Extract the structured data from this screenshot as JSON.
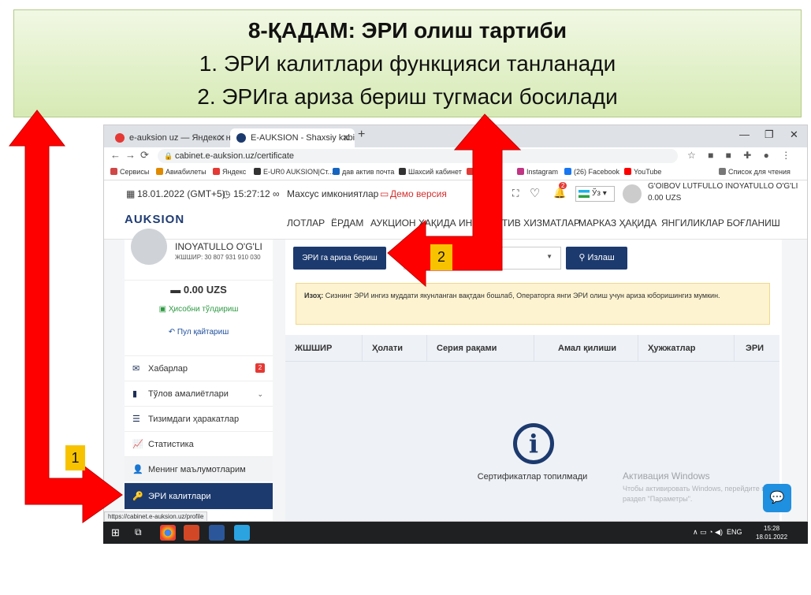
{
  "banner": {
    "title": "8-ҚАДАМ: ЭРИ олиш тартиби",
    "line1": "1.   ЭРИ калитлари функцияси танланади",
    "line2": "2.   ЭРИга ариза бериш тугмаси босилади"
  },
  "browser": {
    "tabs": [
      {
        "label": "e-auksion uz — Яндекс: нашлось"
      },
      {
        "label": "E-AUKSION - Shaxsiy kabinet"
      }
    ],
    "url": "cabinet.e-auksion.uz/certificate",
    "bookmarks": [
      "Сервисы",
      "Авиабилеты",
      "Яндекс",
      "E-UR0 AUKSION|Ст...",
      "дав актив почта",
      "Шахсий кабинет",
      "N",
      "Instagram",
      "(26) Facebook",
      "YouTube",
      "Список для чтения"
    ],
    "status_url": "https://cabinet.e-auksion.uz/profile"
  },
  "site": {
    "date": "18.01.2022 (GMT+5)",
    "time": "15:27:12",
    "special": "Махсус имкониятлар",
    "demo": "Демо версия",
    "notif_count": "2",
    "lang": "Ўз",
    "user_name": "G'OIBOV LUTFULLO INOYATULLO O'G'LI",
    "user_balance": "0.00 UZS",
    "logo": "AUKSION",
    "nav": [
      "ЛОТЛАР",
      "ЁРДАМ",
      "АУКЦИОН ҲАҚИДА",
      "ИНТЕРАКТИВ ХИЗМАТЛАР",
      "МАРКАЗ ҲАҚИДА",
      "ЯНГИЛИКЛАР",
      "БОҒЛАНИШ"
    ]
  },
  "sidebar": {
    "name": "INOYATULLO O'G'LI",
    "inn": "ЖШШИР: 30 807 931 910 030",
    "balance": "0.00 UZS",
    "topup": "Ҳисобни тўлдириш",
    "refund": "Пул қайтариш",
    "items": [
      {
        "label": "Хабарлар",
        "badge": "2"
      },
      {
        "label": "Тўлов амалиётлари"
      },
      {
        "label": "Тизимдаги ҳаракатлар"
      },
      {
        "label": "Статистика"
      },
      {
        "label": "Менинг маълумотларим"
      },
      {
        "label": "ЭРИ калитлари"
      }
    ]
  },
  "main": {
    "apply_button": "ЭРИ га ариза бериш",
    "search_button": "Излаш",
    "notice_label": "Изоҳ:",
    "notice_text": " Сизнинг ЭРИ ингиз муддати якунланган вақтдан бошлаб, Операторга янги ЭРИ олиш учун ариза юборишингиз мумкин.",
    "columns": [
      "ЖШШИР",
      "Ҳолати",
      "Серия рақами",
      "Амал қилиши",
      "Ҳужжатлар",
      "ЭРИ"
    ],
    "empty_text": "Сертификатлар топилмади"
  },
  "windows": {
    "activation_title": "Активация Windows",
    "activation_text_1": "Чтобы активировать Windows, перейдите в",
    "activation_text_2": "раздел \"Параметры\".",
    "lang": "ENG",
    "time": "15:28",
    "date": "18.01.2022"
  },
  "markers": {
    "step1": "1",
    "step2": "2"
  },
  "colors": {
    "accent": "#1c3a6e",
    "arrow": "#ff0000",
    "marker": "#f7c300",
    "banner": "#d6eab4"
  }
}
